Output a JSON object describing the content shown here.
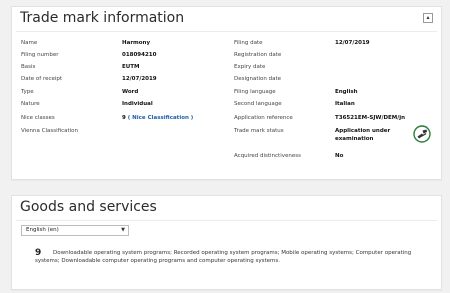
{
  "tm_info": {
    "title": "Trade mark information",
    "left": [
      {
        "label": "Name",
        "value": "Harmony"
      },
      {
        "label": "Filing number",
        "value": "018094210"
      },
      {
        "label": "Basis",
        "value": "EUTM"
      },
      {
        "label": "Date of receipt",
        "value": "12/07/2019"
      },
      {
        "label": "Type",
        "value": "Word"
      },
      {
        "label": "Nature",
        "value": "Individual"
      },
      {
        "label": "Nice classes",
        "value": "9",
        "link": "( Nice Classification )"
      },
      {
        "label": "Vienna Classification",
        "value": ""
      }
    ],
    "right": [
      {
        "label": "Filing date",
        "value": "12/07/2019"
      },
      {
        "label": "Registration date",
        "value": ""
      },
      {
        "label": "Expiry date",
        "value": ""
      },
      {
        "label": "Designation date",
        "value": ""
      },
      {
        "label": "Filing language",
        "value": "English"
      },
      {
        "label": "Second language",
        "value": "Italian"
      },
      {
        "label": "Application reference",
        "value": "T36521EM-SJW/DEM/jn"
      },
      {
        "label": "Trade mark status",
        "value": "Application under",
        "value2": "examination"
      },
      {
        "label": "Acquired distinctiveness",
        "value": "No"
      }
    ],
    "status_icon": "examination-status-icon"
  },
  "goods_services": {
    "title": "Goods and services",
    "language_select": "English (en)",
    "class_number": "9",
    "class_text": "Downloadable operating system programs; Recorded operating system programs; Mobile operating systems; Computer operating systems; Downloadable computer operating programs and computer operating systems."
  },
  "colors": {
    "link": "#1d5fa8",
    "status_icon_green": "#2e7d3a"
  }
}
